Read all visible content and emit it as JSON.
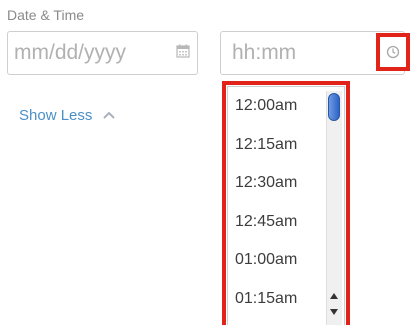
{
  "form": {
    "label": "Date & Time",
    "date_placeholder": "mm/dd/yyyy",
    "time_placeholder": "hh:mm",
    "show_less": "Show Less"
  },
  "time_dropdown": {
    "options": [
      "12:00am",
      "12:15am",
      "12:30am",
      "12:45am",
      "01:00am",
      "01:15am"
    ]
  },
  "icons": {
    "calendar": "calendar-icon",
    "clock": "clock-icon",
    "chevron": "chevron-up-icon",
    "scroll_up": "arrow-up-icon",
    "scroll_down": "arrow-down-icon"
  },
  "colors": {
    "highlight": "#e2231a",
    "link": "#4a90c8",
    "placeholder": "#b1b1b1",
    "scroll_thumb": "#2d63c8"
  }
}
